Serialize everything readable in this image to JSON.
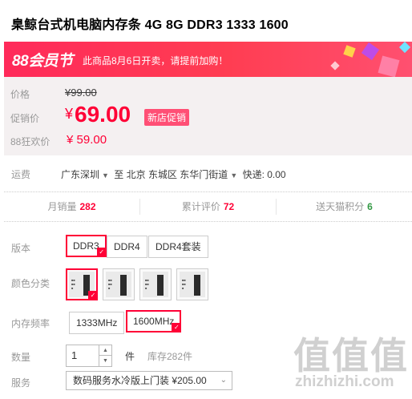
{
  "title": "臬鲸台式机电脑内存条 4G 8G DDR3 1333 1600",
  "banner": {
    "logo": "88会员节",
    "promo": "此商品8月6日开卖，请提前加购！"
  },
  "price": {
    "original_label": "价格",
    "original_value": "¥99.00",
    "sale_label": "促销价",
    "sale_currency": "¥",
    "sale_value": "69.00",
    "sale_tag": "新店促销",
    "festival_label": "88狂欢价",
    "festival_value": "¥ 59.00"
  },
  "shipping": {
    "label": "运费",
    "from": "广东深圳",
    "to_word": "至",
    "destination": "北京 东城区 东华门街道",
    "fee": "快递: 0.00"
  },
  "stats": [
    {
      "label": "月销量",
      "value": "282"
    },
    {
      "label": "累计评价",
      "value": "72"
    },
    {
      "label": "送天猫积分",
      "value": "6"
    }
  ],
  "options": {
    "version_label": "版本",
    "versions": [
      "DDR3",
      "DDR4",
      "DDR4套装"
    ],
    "color_label": "颜色分类",
    "freq_label": "内存频率",
    "freqs": [
      "1333MHz",
      "1600MHz"
    ],
    "qty_label": "数量",
    "qty_value": "1",
    "qty_unit": "件",
    "stock": "库存282件",
    "service_label": "服务",
    "service_value": "数码服务水冷版上门装 ¥205.00"
  },
  "watermark": {
    "big": "值值值",
    "small": "zhizhizhi.com"
  },
  "icons": {
    "qty_up": "triangle-up-icon",
    "qty_down": "triangle-down-icon",
    "dropdown": "chevron-down-icon"
  },
  "colors": {
    "brand_red": "#ff0036",
    "banner": "#ff2a5a",
    "tag_pink": "#ff4f75",
    "green": "#339944"
  }
}
